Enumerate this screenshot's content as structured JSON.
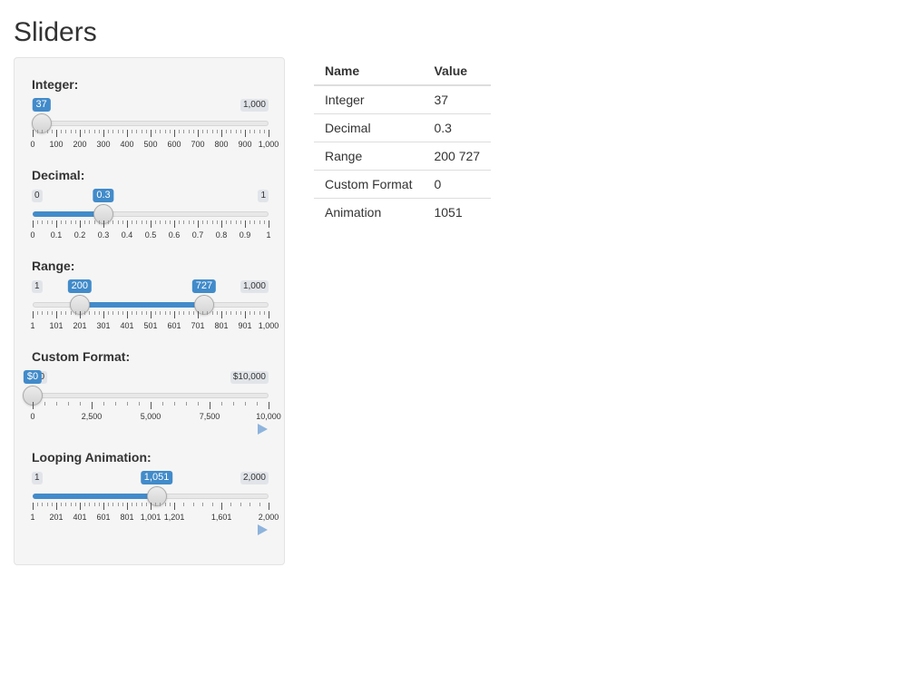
{
  "page": {
    "title": "Sliders"
  },
  "sliders": [
    {
      "label": "Integer:",
      "min_label": "0",
      "max_label": "1,000",
      "value_label": "37",
      "min": 0,
      "max": 1000,
      "value": 37,
      "ticks": [
        "0",
        "100",
        "200",
        "300",
        "400",
        "500",
        "600",
        "700",
        "800",
        "900",
        "1,000"
      ],
      "fill": "left"
    },
    {
      "label": "Decimal:",
      "min_label": "0",
      "max_label": "1",
      "value_label": "0.3",
      "min": 0,
      "max": 1,
      "value": 0.3,
      "ticks": [
        "0",
        "0.1",
        "0.2",
        "0.3",
        "0.4",
        "0.5",
        "0.6",
        "0.7",
        "0.8",
        "0.9",
        "1"
      ],
      "fill": "left"
    },
    {
      "label": "Range:",
      "min_label": "1",
      "max_label": "1,000",
      "value_label": "200",
      "value2_label": "727",
      "min": 1,
      "max": 1000,
      "value": 200,
      "value2": 727,
      "ticks": [
        "1",
        "101",
        "201",
        "301",
        "401",
        "501",
        "601",
        "701",
        "801",
        "901",
        "1,000"
      ],
      "fill": "range"
    },
    {
      "label": "Custom Format:",
      "min_label": "$0",
      "max_label": "$10,000",
      "value_label": "$0",
      "min": 0,
      "max": 10000,
      "value": 0,
      "ticks": [
        "0",
        "2,500",
        "5,000",
        "7,500",
        "10,000"
      ],
      "fill": "none",
      "play": true
    },
    {
      "label": "Looping Animation:",
      "min_label": "1",
      "max_label": "2,000",
      "value_label": "1,051",
      "min": 1,
      "max": 2000,
      "value": 1051,
      "ticks": [
        "1",
        "201",
        "401",
        "601",
        "801",
        "1,001",
        "1,201",
        "1,601",
        "2,000"
      ],
      "tick_values": [
        1,
        201,
        401,
        601,
        801,
        1001,
        1201,
        1601,
        2000
      ],
      "fill": "left",
      "play": true
    }
  ],
  "table": {
    "headers": [
      "Name",
      "Value"
    ],
    "rows": [
      [
        "Integer",
        "37"
      ],
      [
        "Decimal",
        "0.3"
      ],
      [
        "Range",
        "200 727"
      ],
      [
        "Custom Format",
        "0"
      ],
      [
        "Animation",
        "1051"
      ]
    ]
  },
  "colors": {
    "accent": "#428bca",
    "panel": "#f5f5f5"
  }
}
